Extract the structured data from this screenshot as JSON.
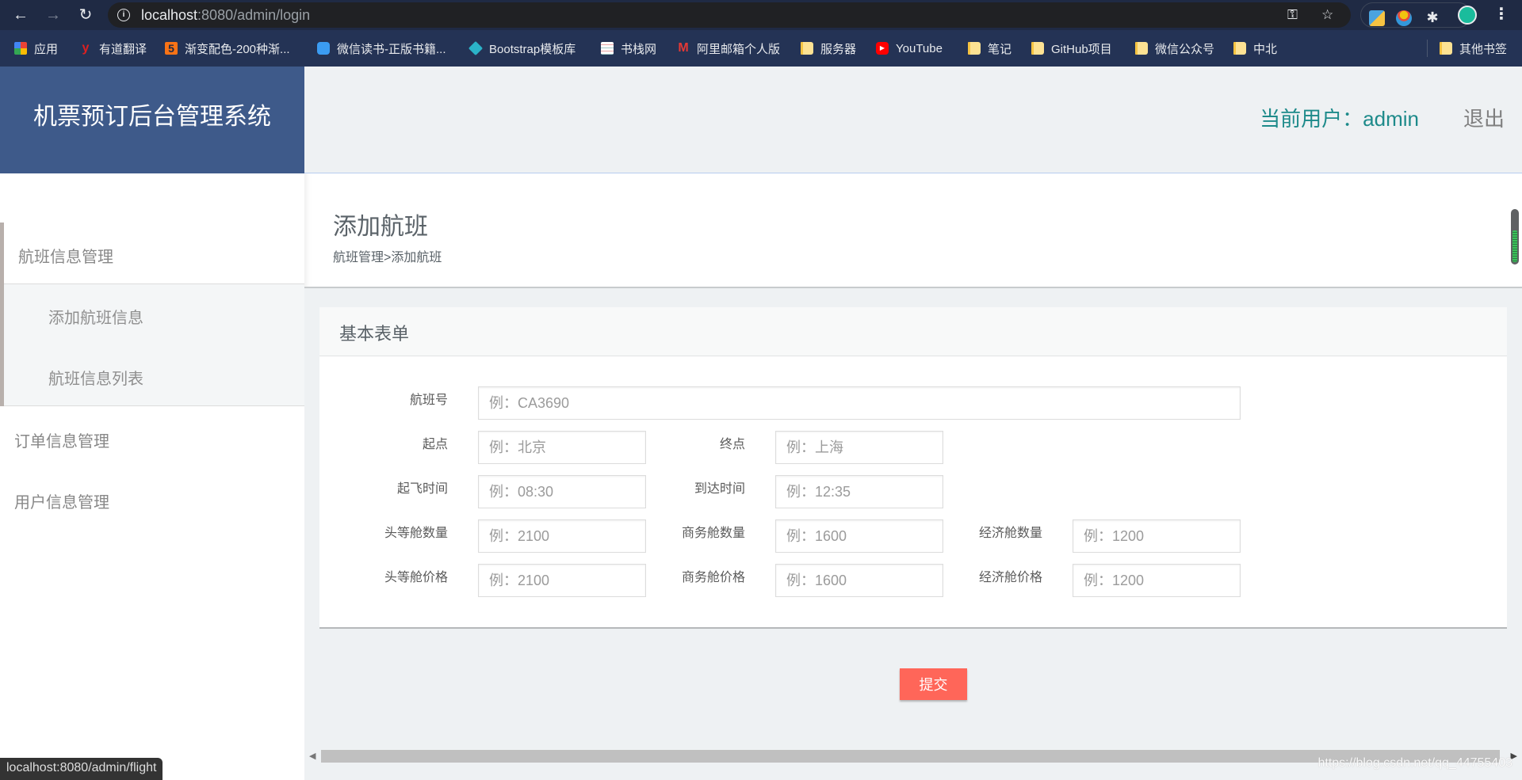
{
  "browser": {
    "url_host": "localhost",
    "url_rest": ":8080/admin/login",
    "status_url": "localhost:8080/admin/flight",
    "bookmarks": [
      {
        "label": "应用",
        "icon": "apps-grid-icon"
      },
      {
        "label": "有道翻译",
        "icon": "youdao-icon"
      },
      {
        "label": "渐变配色-200种渐...",
        "icon": "gradient-site-icon"
      },
      {
        "label": "微信读书-正版书籍...",
        "icon": "weread-icon"
      },
      {
        "label": "Bootstrap模板库",
        "icon": "bootstrap-icon"
      },
      {
        "label": "书栈网",
        "icon": "bookstack-icon"
      },
      {
        "label": "阿里邮箱个人版",
        "icon": "alimail-icon"
      },
      {
        "label": "服务器",
        "icon": "folder-icon"
      },
      {
        "label": "YouTube",
        "icon": "youtube-icon"
      },
      {
        "label": "笔记",
        "icon": "folder-icon"
      },
      {
        "label": "GitHub项目",
        "icon": "folder-icon"
      },
      {
        "label": "微信公众号",
        "icon": "folder-icon"
      },
      {
        "label": "中北",
        "icon": "folder-icon"
      },
      {
        "label": "其他书签",
        "icon": "folder-icon"
      }
    ]
  },
  "app": {
    "brand": "机票预订后台管理系统",
    "current_user": "当前用户：admin",
    "logout": "退出"
  },
  "sidebar": {
    "groups": [
      {
        "label": "航班信息管理",
        "expanded": true,
        "items": [
          {
            "label": "添加航班信息"
          },
          {
            "label": "航班信息列表"
          }
        ]
      },
      {
        "label": "订单信息管理"
      },
      {
        "label": "用户信息管理"
      }
    ]
  },
  "page": {
    "title": "添加航班",
    "breadcrumb": "航班管理>添加航班"
  },
  "form": {
    "card_title": "基本表单",
    "fields": {
      "flight_no": {
        "label": "航班号",
        "placeholder": "例：CA3690"
      },
      "origin": {
        "label": "起点",
        "placeholder": "例：北京"
      },
      "destination": {
        "label": "终点",
        "placeholder": "例：上海"
      },
      "depart_time": {
        "label": "起飞时间",
        "placeholder": "例：08:30"
      },
      "arrive_time": {
        "label": "到达时间",
        "placeholder": "例：12:35"
      },
      "first_count": {
        "label": "头等舱数量",
        "placeholder": "例：2100"
      },
      "business_count": {
        "label": "商务舱数量",
        "placeholder": "例：1600"
      },
      "economy_count": {
        "label": "经济舱数量",
        "placeholder": "例：1200"
      },
      "first_price": {
        "label": "头等舱价格",
        "placeholder": "例：2100"
      },
      "business_price": {
        "label": "商务舱价格",
        "placeholder": "例：1600"
      },
      "economy_price": {
        "label": "经济舱价格",
        "placeholder": "例：1200"
      }
    },
    "submit_label": "提交"
  },
  "watermark": "https://blog.csdn.net/qq_44755403",
  "colors": {
    "brand_bg": "#3e5a8a",
    "user_text": "#1d8a8a",
    "submit_bg": "#ff6659"
  }
}
